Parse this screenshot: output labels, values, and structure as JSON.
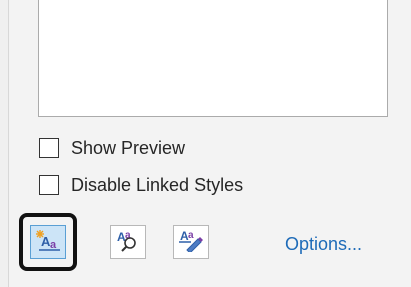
{
  "checkboxes": [
    {
      "label": "Show Preview",
      "checked": false
    },
    {
      "label": "Disable Linked Styles",
      "checked": false
    }
  ],
  "toolbar": {
    "new_style_icon": "new-style-icon",
    "style_inspector_icon": "style-inspector-icon",
    "manage_styles_icon": "manage-styles-icon",
    "options_label": "Options..."
  },
  "colors": {
    "selected_fill": "#cce4f7",
    "link": "#1e6bb8",
    "icon_blue": "#2e5fa8",
    "icon_purple": "#7b3fa6"
  }
}
